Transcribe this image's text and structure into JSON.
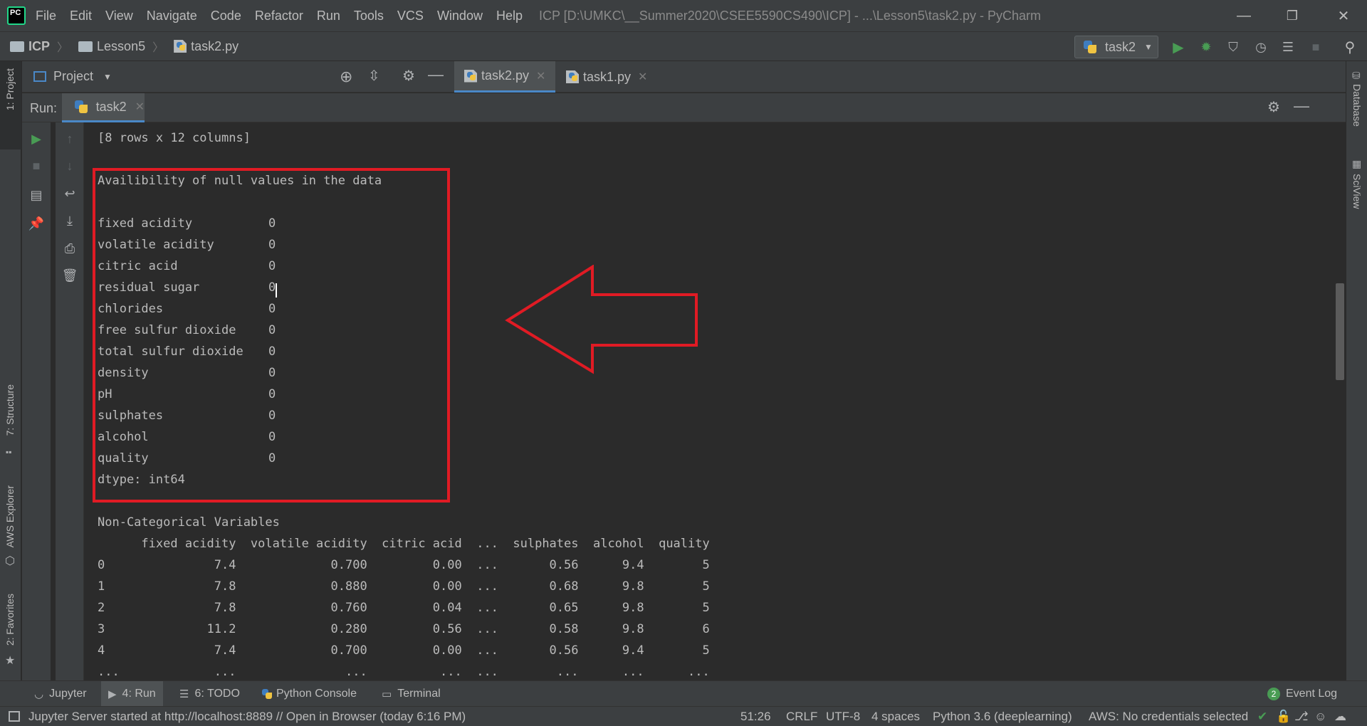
{
  "titlebar": {
    "menu": [
      "File",
      "Edit",
      "View",
      "Navigate",
      "Code",
      "Refactor",
      "Run",
      "Tools",
      "VCS",
      "Window",
      "Help"
    ],
    "window_title": "ICP [D:\\UMKC\\__Summer2020\\CSEE5590CS490\\ICP] - ...\\Lesson5\\task2.py - PyCharm",
    "minimize": "—",
    "restore": "❐",
    "close": "✕"
  },
  "navbar": {
    "crumbs": [
      "ICP",
      "Lesson5",
      "task2.py"
    ],
    "run_config": "task2"
  },
  "left_strip": {
    "project": "1: Project",
    "structure": "7: Structure",
    "aws": "AWS Explorer",
    "favorites": "2: Favorites"
  },
  "right_strip": {
    "database": "Database",
    "sciview": "SciView"
  },
  "project_panel": {
    "title": "Project"
  },
  "editor_tabs": [
    "task2.py",
    "task1.py"
  ],
  "run_panel": {
    "label": "Run:",
    "tab": "task2"
  },
  "console": {
    "shape_line": "[8 rows x 12 columns]",
    "null_header": "Availibility of null values in the data",
    "null_rows": [
      {
        "name": "fixed acidity",
        "value": "0"
      },
      {
        "name": "volatile acidity",
        "value": "0"
      },
      {
        "name": "citric acid",
        "value": "0"
      },
      {
        "name": "residual sugar",
        "value": "0"
      },
      {
        "name": "chlorides",
        "value": "0"
      },
      {
        "name": "free sulfur dioxide",
        "value": "0"
      },
      {
        "name": "total sulfur dioxide",
        "value": "0"
      },
      {
        "name": "density",
        "value": "0"
      },
      {
        "name": "pH",
        "value": "0"
      },
      {
        "name": "sulphates",
        "value": "0"
      },
      {
        "name": "alcohol",
        "value": "0"
      },
      {
        "name": "quality",
        "value": "0"
      }
    ],
    "dtype_line": "dtype: int64",
    "noncat_header": "Non-Categorical Variables",
    "table_header": "      fixed acidity  volatile acidity  citric acid  ...  sulphates  alcohol  quality",
    "table_rows": [
      "0               7.4             0.700         0.00  ...       0.56      9.4        5",
      "1               7.8             0.880         0.00  ...       0.68      9.8        5",
      "2               7.8             0.760         0.04  ...       0.65      9.8        5",
      "3              11.2             0.280         0.56  ...       0.58      9.8        6",
      "4               7.4             0.700         0.00  ...       0.56      9.4        5",
      "...             ...               ...          ...  ...        ...      ...      ..."
    ]
  },
  "bottom_tools": {
    "jupyter": "Jupyter",
    "run": "4: Run",
    "todo": "6: TODO",
    "python_console": "Python Console",
    "terminal": "Terminal",
    "event_log_count": "2",
    "event_log": "Event Log"
  },
  "status": {
    "message": "Jupyter Server started at http://localhost:8889 // Open in Browser (today 6:16 PM)",
    "position": "51:26",
    "line_sep": "CRLF",
    "encoding": "UTF-8",
    "indent": "4 spaces",
    "interpreter": "Python 3.6 (deeplearning)",
    "aws": "AWS: No credentials selected"
  },
  "colors": {
    "highlight": "#e01b24",
    "run_green": "#499c54",
    "accent_blue": "#4a88c7"
  }
}
